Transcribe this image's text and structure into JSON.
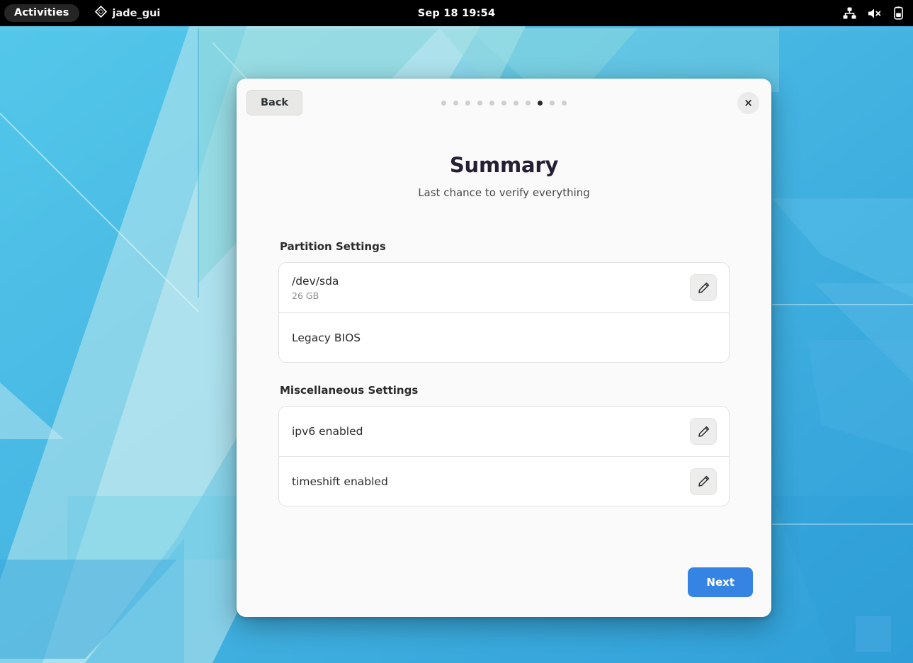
{
  "topbar": {
    "activities_label": "Activities",
    "app_name": "jade_gui",
    "app_icon": "app-diamond-icon",
    "clock": "Sep 18  19:54",
    "tray_icons": [
      "wired-network-icon",
      "volume-muted-icon",
      "battery-icon"
    ]
  },
  "dialog": {
    "back_label": "Back",
    "close_label": "×",
    "title": "Summary",
    "subtitle": "Last chance to verify everything",
    "pager": {
      "total": 11,
      "active_index": 8
    },
    "next_label": "Next",
    "accent_color": "#3584e4",
    "sections": [
      {
        "label": "Partition Settings",
        "rows": [
          {
            "title": "/dev/sda",
            "sub": "26 GB",
            "edit": true
          },
          {
            "title": "Legacy BIOS",
            "sub": "",
            "edit": false
          }
        ]
      },
      {
        "label": "Miscellaneous Settings",
        "rows": [
          {
            "title": "ipv6 enabled",
            "sub": "",
            "edit": true
          },
          {
            "title": "timeshift enabled",
            "sub": "",
            "edit": true
          }
        ]
      }
    ]
  }
}
